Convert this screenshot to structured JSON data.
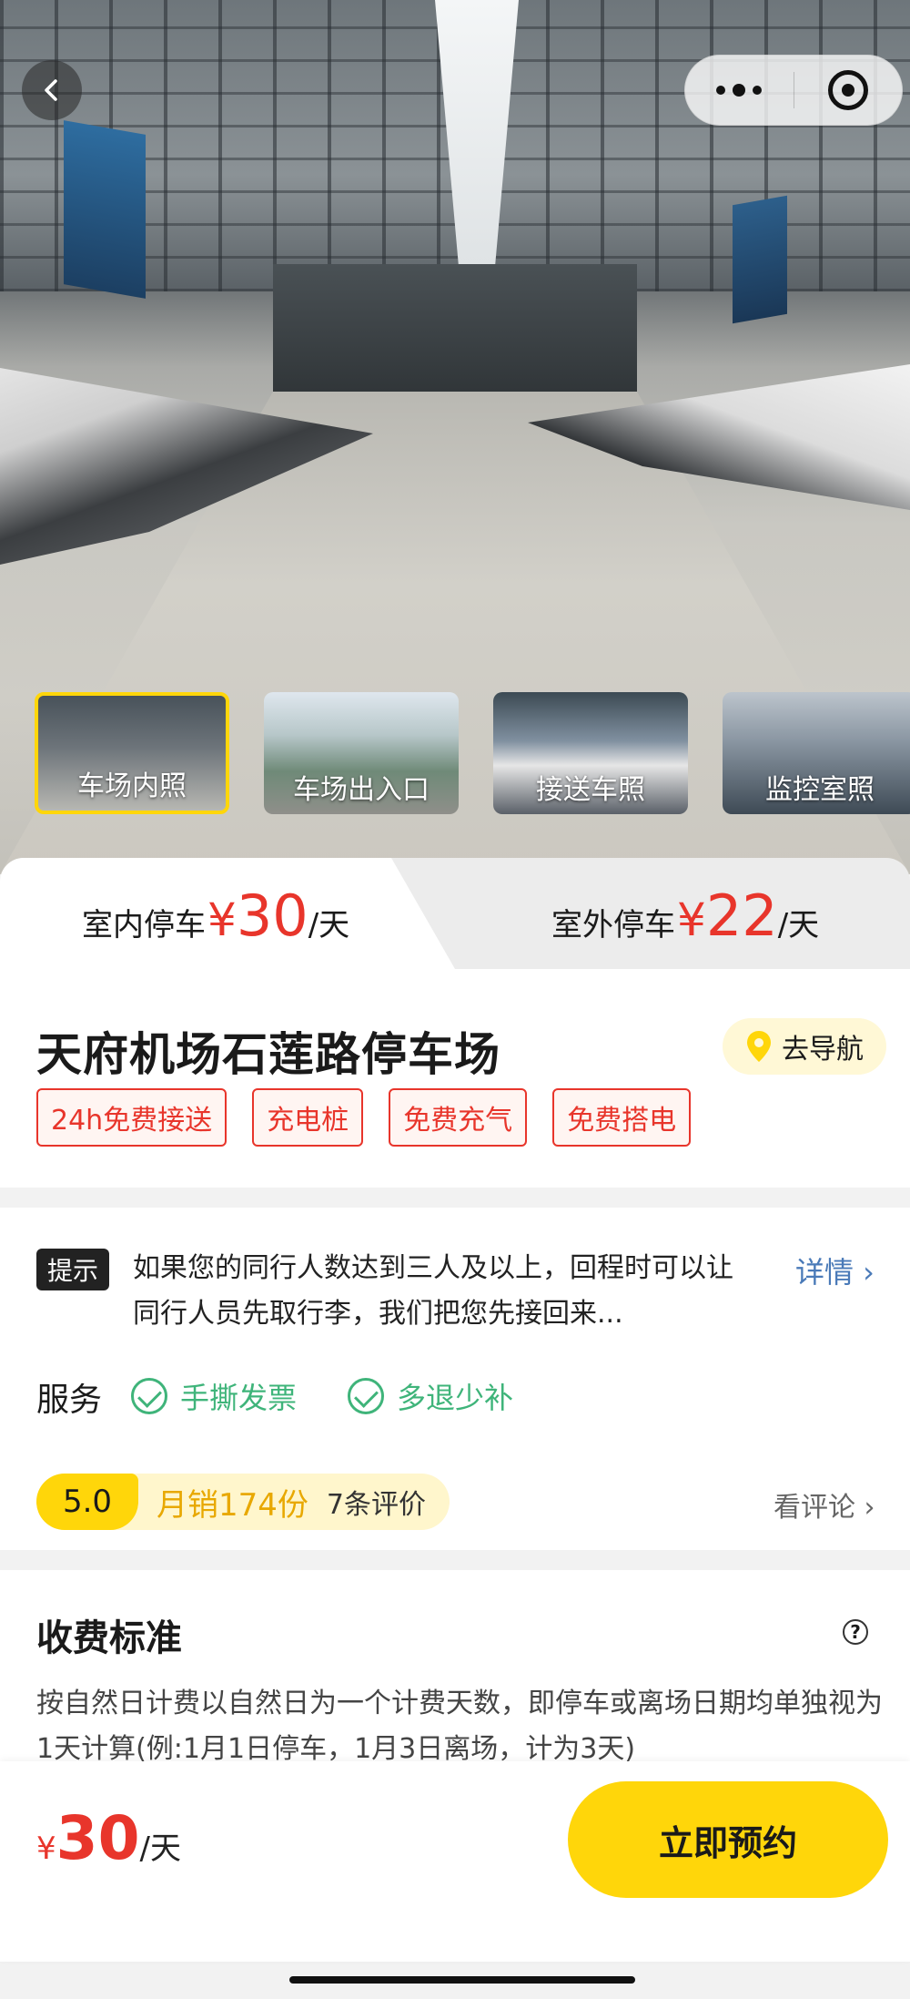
{
  "gallery": {
    "thumbnails": [
      {
        "label": "车场内照",
        "active": true
      },
      {
        "label": "车场出入口",
        "active": false
      },
      {
        "label": "接送车照",
        "active": false
      },
      {
        "label": "监控室照",
        "active": false
      }
    ]
  },
  "price_tabs": [
    {
      "label": "室内停车",
      "currency": "¥",
      "amount": "30",
      "unit": "/天",
      "active": true
    },
    {
      "label": "室外停车",
      "currency": "¥",
      "amount": "22",
      "unit": "/天",
      "active": false
    }
  ],
  "lot": {
    "name": "天府机场石莲路停车场",
    "nav_label": "去导航",
    "tags": [
      "24h免费接送",
      "充电桩",
      "免费充气",
      "免费搭电"
    ]
  },
  "notice": {
    "badge": "提示",
    "text": "如果您的同行人数达到三人及以上，回程时可以让同行人员先取行李，我们把您先接回来...",
    "detail_label": "详情 ›"
  },
  "services": {
    "label": "服务",
    "items": [
      "手撕发票",
      "多退少补"
    ]
  },
  "rating": {
    "score": "5.0",
    "sales": "月销174份",
    "reviews": "7条评价",
    "see_reviews": "看评论 ›"
  },
  "fee": {
    "title": "收费标准",
    "text": "按自然日计费以自然日为一个计费天数，即停车或离场日期均单独视为1天计算(例:1月1日停车，1月3日离场，计为3天)"
  },
  "bottom_bar": {
    "currency": "¥",
    "amount": "30",
    "unit": "/天",
    "book_label": "立即预约"
  },
  "colors": {
    "accent_red": "#e8352b",
    "accent_yellow": "#ffd60a",
    "service_green": "#3fb47a",
    "link_blue": "#4a7ab8"
  }
}
